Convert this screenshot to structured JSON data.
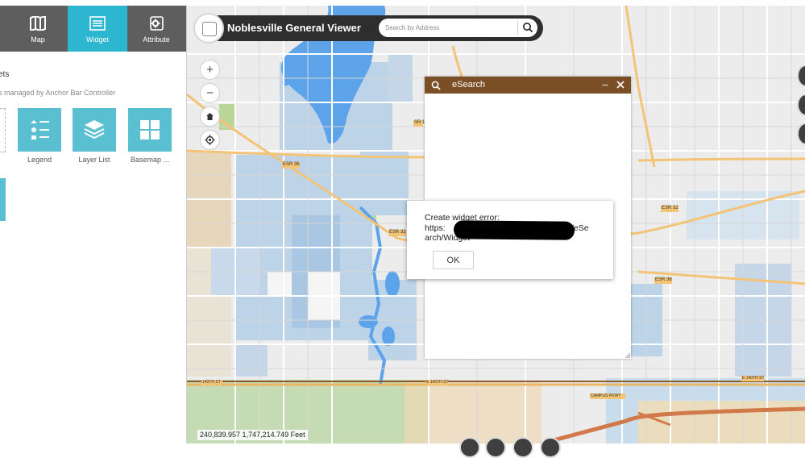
{
  "tabs": [
    {
      "label": "Map",
      "icon": "map-icon",
      "active": false
    },
    {
      "label": "Widget",
      "icon": "widget-list-icon",
      "active": true
    },
    {
      "label": "Attribute",
      "icon": "gear-icon",
      "active": false
    }
  ],
  "panel": {
    "heading": "ets",
    "subheading": "s managed by Anchor Bar Controller",
    "tiles": [
      {
        "label": "Legend",
        "icon": "legend-icon"
      },
      {
        "label": "Layer List",
        "icon": "layers-icon"
      },
      {
        "label": "Basemap ...",
        "icon": "basemap-grid-icon"
      }
    ]
  },
  "header": {
    "title": "Noblesville General Viewer",
    "search_placeholder": "Search by Address"
  },
  "map_controls": {
    "zoom_in": "+",
    "zoom_out": "−"
  },
  "map_labels": {
    "sr1": "SR 1",
    "esr36_left": "ESR 36",
    "esr32_mid": "ESR 32",
    "esr32_right": "ESR 32",
    "esr36_right": "ESR 36",
    "st140_left": "140TH ST",
    "st140_mid": "E 140TH ST",
    "st140_right": "E 140TH ST",
    "campus_pkwy": "CAMPUS PKWY"
  },
  "coordinates": "240,839.957 1,747,214.749 Feet",
  "esearch": {
    "title": "eSearch"
  },
  "error_dialog": {
    "line1": "Create widget error:",
    "line2": "https:",
    "line2_tail": "/eSe",
    "line3": "arch/Widget",
    "ok_label": "OK"
  },
  "colors": {
    "tab_bar": "#5e5e5e",
    "tab_active": "#2db6cf",
    "tile": "#59bfd1",
    "esearch_header": "#7b4f25",
    "water": "#5da3ea",
    "parcel": "#b7cfe3",
    "road_major": "#f3c376"
  }
}
